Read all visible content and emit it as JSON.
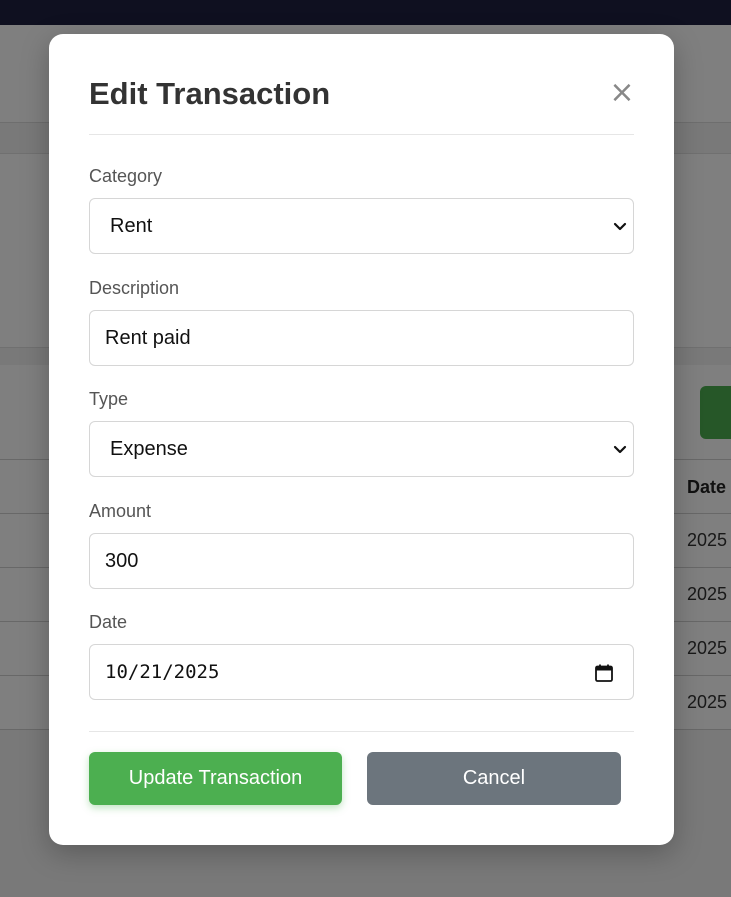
{
  "modal": {
    "title": "Edit Transaction",
    "close_label": "×",
    "fields": {
      "category": {
        "label": "Category",
        "value": "Rent"
      },
      "description": {
        "label": "Description",
        "value": "Rent paid"
      },
      "type": {
        "label": "Type",
        "value": "Expense"
      },
      "amount": {
        "label": "Amount",
        "value": "300"
      },
      "date": {
        "label": "Date",
        "value": "10/21/2025"
      }
    },
    "buttons": {
      "update_label": "Update Transaction",
      "cancel_label": "Cancel"
    }
  },
  "background": {
    "table_header_date": "Date",
    "table_dates": [
      "2025",
      "2025",
      "2025",
      "2025"
    ]
  },
  "colors": {
    "primary": "#4caf50",
    "secondary": "#6c757d",
    "topbar": "#1f2040"
  }
}
